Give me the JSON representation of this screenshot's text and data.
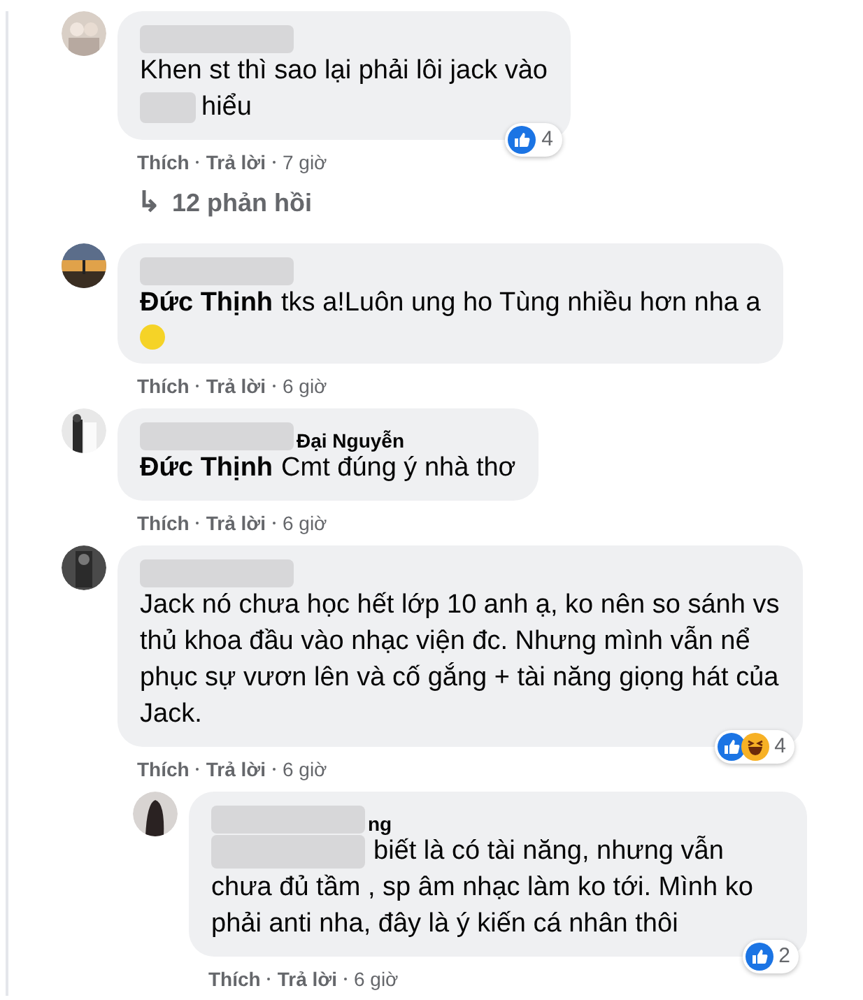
{
  "comments": [
    {
      "kind": "comment",
      "text": "Khen st thì sao lại phải lôi jack vào",
      "after_blur": "hiểu",
      "reactions": [
        {
          "kind": "like"
        }
      ],
      "reaction_count": "4",
      "actions": {
        "like": "Thích",
        "reply": "Trả lời",
        "time": "7 giờ"
      },
      "replies_link": {
        "arrow": "↳",
        "label": "12 phản hồi"
      }
    },
    {
      "kind": "comment",
      "mention": "Đức Thịnh",
      "text": "tks a!Luôn ung ho Tùng nhiều hơn nha a",
      "emoji": true,
      "actions": {
        "like": "Thích",
        "reply": "Trả lời",
        "time": "6 giờ"
      }
    },
    {
      "kind": "comment",
      "name_fragment": "Đại Nguyễn",
      "mention": "Đức Thịnh",
      "text": "Cmt đúng ý nhà thơ",
      "actions": {
        "like": "Thích",
        "reply": "Trả lời",
        "time": "6 giờ"
      }
    },
    {
      "kind": "comment",
      "text": "Jack nó chưa học hết lớp 10 anh ạ, ko nên so sánh vs thủ khoa đầu vào nhạc viện đc. Nhưng mình vẫn nể phục sự vươn lên và cố gắng + tài năng giọng hát của Jack.",
      "reactions": [
        {
          "kind": "like"
        },
        {
          "kind": "haha"
        }
      ],
      "reaction_count": "4",
      "actions": {
        "like": "Thích",
        "reply": "Trả lời",
        "time": "6 giờ"
      },
      "children": [
        {
          "kind": "comment",
          "name_fragment": "ng",
          "first_line_after_blur": "biết là có tài năng, nhưng vẫn",
          "text": "chưa đủ tầm , sp âm nhạc làm ko tới. Mình ko phải anti nha, đây là ý kiến cá nhân thôi",
          "reactions": [
            {
              "kind": "like"
            }
          ],
          "reaction_count": "2",
          "actions": {
            "like": "Thích",
            "reply": "Trả lời",
            "time": "6 giờ"
          }
        }
      ]
    }
  ]
}
